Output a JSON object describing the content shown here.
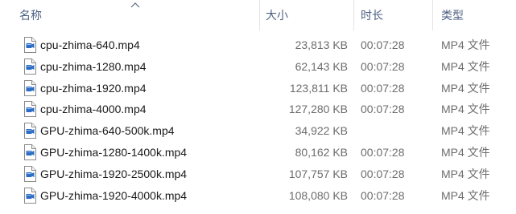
{
  "columns": {
    "name": "名称",
    "size": "大小",
    "duration": "时长",
    "type": "类型"
  },
  "sort": {
    "column": "name",
    "direction": "ascending",
    "icon": "sort-up-chevron-icon"
  },
  "file_icon": "video-file-icon",
  "files": [
    {
      "name": "cpu-zhima-640.mp4",
      "size": "23,813 KB",
      "duration": "00:07:28",
      "type": "MP4 文件"
    },
    {
      "name": "cpu-zhima-1280.mp4",
      "size": "62,143 KB",
      "duration": "00:07:28",
      "type": "MP4 文件"
    },
    {
      "name": "cpu-zhima-1920.mp4",
      "size": "123,811 KB",
      "duration": "00:07:28",
      "type": "MP4 文件"
    },
    {
      "name": "cpu-zhima-4000.mp4",
      "size": "127,280 KB",
      "duration": "00:07:28",
      "type": "MP4 文件"
    },
    {
      "name": "GPU-zhima-640-500k.mp4",
      "size": "34,922 KB",
      "duration": "",
      "type": "MP4 文件"
    },
    {
      "name": "GPU-zhima-1280-1400k.mp4",
      "size": "80,162 KB",
      "duration": "00:07:28",
      "type": "MP4 文件"
    },
    {
      "name": "GPU-zhima-1920-2500k.mp4",
      "size": "107,757 KB",
      "duration": "00:07:28",
      "type": "MP4 文件"
    },
    {
      "name": "GPU-zhima-1920-4000k.mp4",
      "size": "108,080 KB",
      "duration": "00:07:28",
      "type": "MP4 文件"
    }
  ]
}
